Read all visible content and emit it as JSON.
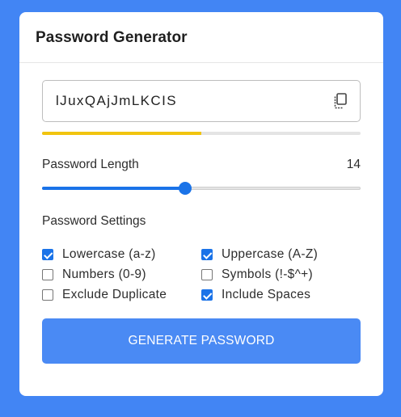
{
  "card": {
    "title": "Password Generator"
  },
  "password": {
    "value": "lJuxQAjJmLKCIS",
    "copy_icon": "copy-icon",
    "strength_fraction": 0.5,
    "strength_color": "#f1c40f"
  },
  "length": {
    "label": "Password Length",
    "value": "14",
    "slider_fraction": 0.45
  },
  "settings": {
    "title": "Password Settings",
    "options": [
      {
        "label": "Lowercase (a-z)",
        "checked": true
      },
      {
        "label": "Uppercase (A-Z)",
        "checked": true
      },
      {
        "label": "Numbers (0-9)",
        "checked": false
      },
      {
        "label": "Symbols (!-$^+)",
        "checked": false
      },
      {
        "label": "Exclude Duplicate",
        "checked": false
      },
      {
        "label": "Include Spaces",
        "checked": true
      }
    ]
  },
  "generate_button": {
    "label": "GENERATE PASSWORD"
  },
  "colors": {
    "background": "#4285f4",
    "accent": "#1a73e8",
    "button": "#4a8af4"
  }
}
